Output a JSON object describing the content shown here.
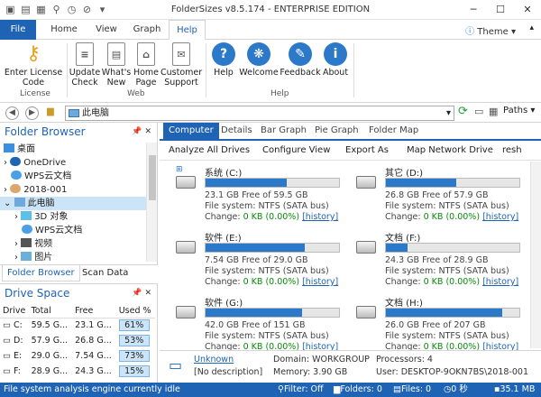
{
  "window": {
    "title": "FolderSizes v8.5.174 - ENTERPRISE EDITION"
  },
  "ribbon_tabs": [
    "File",
    "Home",
    "View",
    "Graph",
    "Help"
  ],
  "theme_label": "Theme",
  "ribbon": {
    "groups": [
      {
        "label": "License",
        "buttons": [
          "Enter License\nCode"
        ]
      },
      {
        "label": "Web",
        "buttons": [
          "Update\nCheck",
          "What's\nNew",
          "Home\nPage",
          "Customer\nSupport"
        ]
      },
      {
        "label": "Help",
        "buttons": [
          "Help",
          "Welcome",
          "Feedback",
          "About"
        ]
      }
    ]
  },
  "address": {
    "value": "此电脑",
    "paths_label": "Paths"
  },
  "folder_browser": {
    "title": "Folder Browser",
    "tree": [
      {
        "label": "桌面",
        "icon": "desktop-icon"
      },
      {
        "label": "OneDrive",
        "icon": "cloud-icon"
      },
      {
        "label": "WPS云文档",
        "icon": "cloud-doc-icon"
      },
      {
        "label": "2018-001",
        "icon": "user-icon"
      },
      {
        "label": "此电脑",
        "icon": "computer-icon"
      },
      {
        "label": "3D 对象",
        "icon": "folder-3d-icon"
      },
      {
        "label": "WPS云文档",
        "icon": "cloud-doc-icon"
      },
      {
        "label": "视频",
        "icon": "video-icon"
      },
      {
        "label": "图片",
        "icon": "pictures-icon"
      }
    ],
    "tabs": [
      "Folder Browser",
      "Scan Data"
    ]
  },
  "drive_space": {
    "title": "Drive Space",
    "columns": [
      "Drive",
      "Total",
      "Free",
      "Used %"
    ],
    "rows": [
      {
        "drive": "C:",
        "total": "59.5 G...",
        "free": "23.1 G...",
        "used": "61%"
      },
      {
        "drive": "D:",
        "total": "57.9 G...",
        "free": "26.8 G...",
        "used": "53%"
      },
      {
        "drive": "E:",
        "total": "29.0 G...",
        "free": "7.54 G...",
        "used": "73%"
      },
      {
        "drive": "F:",
        "total": "28.9 G...",
        "free": "24.3 G...",
        "used": "15%"
      }
    ]
  },
  "right_tabs": [
    "Computer",
    "Details",
    "Bar Graph",
    "Pie Graph",
    "Folder Map"
  ],
  "right_toolbar": [
    "Analyze All Drives",
    "Configure View",
    "Export As",
    "Map Network Drive",
    "resh"
  ],
  "drives": [
    {
      "name": "系统 (C:)",
      "free": "23.1 GB Free of 59.5 GB",
      "fs": "File system: NTFS (SATA bus)",
      "change_label": "Change:",
      "change": "0 KB (0.00%)",
      "history": "[history]",
      "used_frac": 0.61,
      "windows": true
    },
    {
      "name": "其它 (D:)",
      "free": "26.8 GB Free of 57.9 GB",
      "fs": "File system: NTFS (SATA bus)",
      "change_label": "Change:",
      "change": "0 KB (0.00%)",
      "history": "[history]",
      "used_frac": 0.53,
      "windows": false
    },
    {
      "name": "软件 (E:)",
      "free": "7.54 GB Free of 29.0 GB",
      "fs": "File system: NTFS (SATA bus)",
      "change_label": "Change:",
      "change": "0 KB (0.00%)",
      "history": "[history]",
      "used_frac": 0.74,
      "windows": false
    },
    {
      "name": "文档 (F:)",
      "free": "24.3 GB Free of 28.9 GB",
      "fs": "File system: NTFS (SATA bus)",
      "change_label": "Change:",
      "change": "0 KB (0.00%)",
      "history": "[history]",
      "used_frac": 0.16,
      "windows": false
    },
    {
      "name": "软件 (G:)",
      "free": "42.0 GB Free of 151 GB",
      "fs": "File system: NTFS (SATA bus)",
      "change_label": "Change:",
      "change": "0 KB (0.00%)",
      "history": "[history]",
      "used_frac": 0.72,
      "windows": false
    },
    {
      "name": "文档 (H:)",
      "free": "26.0 GB Free of 207 GB",
      "fs": "File system: NTFS (SATA bus)",
      "change_label": "Change:",
      "change": "0 KB (0.00%)",
      "history": "[history]",
      "used_frac": 0.87,
      "windows": false
    }
  ],
  "info": {
    "computer": "Unknown",
    "description": "[No description]",
    "domain": "Domain: WORKGROUP",
    "memory": "Memory: 3.90 GB",
    "user": "User: DESKTOP-9OKN7BS\\2018-001",
    "processors": "Processors: 4"
  },
  "status": {
    "message": "File system analysis engine currently idle",
    "filter": "Filter: Off",
    "folders": "Folders: 0",
    "files": "Files: 0",
    "time": "0 秒",
    "memory": "35.1 MB"
  },
  "colors": {
    "accent": "#1e63b4",
    "bar": "#2b79c8"
  }
}
